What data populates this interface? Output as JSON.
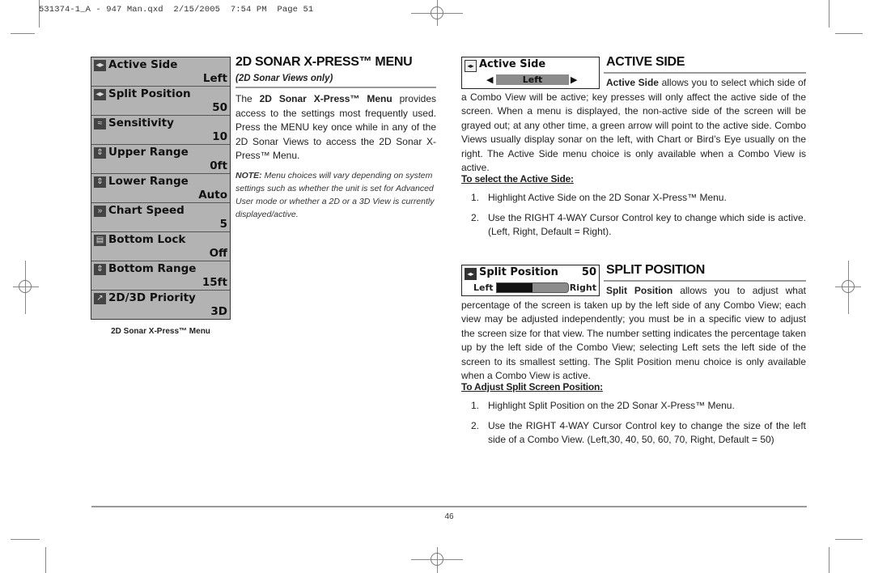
{
  "slug": "531374-1_A - 947 Man.qxd  2/15/2005  7:54 PM  Page 51",
  "menu": {
    "caption": "2D Sonar X-Press™ Menu",
    "items": [
      {
        "label": "Active Side",
        "value": "Left",
        "icon": "active-side-icon",
        "glyph": "◂▸"
      },
      {
        "label": "Split Position",
        "value": "50",
        "icon": "split-position-icon",
        "glyph": "◂▸"
      },
      {
        "label": "Sensitivity",
        "value": "10",
        "icon": "sensitivity-icon",
        "glyph": "≈"
      },
      {
        "label": "Upper Range",
        "value": "0ft",
        "icon": "upper-range-icon",
        "glyph": "⇕"
      },
      {
        "label": "Lower Range",
        "value": "Auto",
        "icon": "lower-range-icon",
        "glyph": "⇕"
      },
      {
        "label": "Chart Speed",
        "value": "5",
        "icon": "chart-speed-icon",
        "glyph": "»"
      },
      {
        "label": "Bottom Lock",
        "value": "Off",
        "icon": "bottom-lock-icon",
        "glyph": "▤"
      },
      {
        "label": "Bottom Range",
        "value": "15ft",
        "icon": "bottom-range-icon",
        "glyph": "⇕"
      },
      {
        "label": "2D/3D Priority",
        "value": "3D",
        "icon": "priority-icon",
        "glyph": "↗"
      }
    ]
  },
  "intro": {
    "title": "2D SONAR  X-PRESS™ MENU",
    "subtitle": "(2D Sonar Views only)",
    "body_lead": "The ",
    "body_bold": "2D Sonar X-Press™ Menu",
    "body_rest": " provides access to the settings most frequently used. Press the MENU key once while in any of the 2D Sonar Views to access the 2D Sonar X-Press™ Menu.",
    "note_label": "NOTE:",
    "note_text": " Menu choices will vary depending on system settings such as whether the unit is set for Advanced User mode or whether a 2D or a 3D View is currently displayed/active."
  },
  "active_side": {
    "widget_title": "Active Side",
    "widget_value": "Left",
    "title": "ACTIVE SIDE",
    "body_bold": "Active Side",
    "body_rest": " allows you to select which side of a Combo View will be active; key presses will only affect the active side of the screen. When a menu is displayed, the non-active side of the screen will be grayed out; at any other time, a green arrow will point to the active side. Combo Views usually display sonar on the left, with Chart or Bird’s Eye usually on the right. The Active Side menu choice is only available when a Combo View is active.",
    "steps_heading": "To select the Active Side:",
    "steps": [
      {
        "num": "1.",
        "text": "Highlight Active Side on the 2D Sonar X-Press™ Menu."
      },
      {
        "num": "2.",
        "text": "Use the RIGHT 4-WAY Cursor Control key to change which side is active. (Left, Right, Default = Right)."
      }
    ]
  },
  "split_position": {
    "widget_title": "Split Position",
    "widget_value": "50",
    "slider_left": "Left",
    "slider_right": "Right",
    "slider_percent": 50,
    "title": "SPLIT POSITION",
    "body_bold": "Split Position",
    "body_rest": " allows you to adjust what percentage of the screen is taken up by the left side of any Combo View; each view may be adjusted independently; you must be in a specific view to adjust the screen size for that view. The number setting indicates the percentage taken up by the left side of the Combo View; selecting Left sets the left side of the screen to its smallest setting. The Split Position menu choice is only available when a Combo View is active.",
    "steps_heading": "To Adjust Split Screen Position:",
    "steps": [
      {
        "num": "1.",
        "text": "Highlight Split Position on the 2D Sonar X-Press™ Menu."
      },
      {
        "num": "2.",
        "text": "Use the RIGHT 4-WAY Cursor Control key to change the size of the left side of a Combo View. (Left,30, 40, 50, 60, 70, Right, Default = 50)"
      }
    ]
  },
  "footer": {
    "page_number": "46"
  }
}
